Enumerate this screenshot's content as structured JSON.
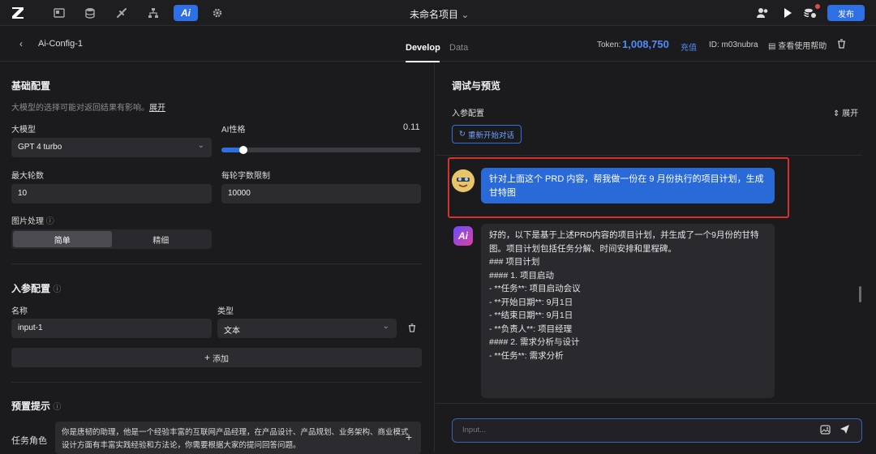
{
  "topbar": {
    "project_title": "未命名项目",
    "publish_label": "发布",
    "nav_icons": [
      "layout-icon",
      "database-icon",
      "plugin-icon",
      "workflow-icon",
      "ai-icon",
      "gear-icon"
    ],
    "ai_tab_label": "Ai"
  },
  "header": {
    "config_name": "Ai-Config-1",
    "tabs": [
      {
        "label": "Develop"
      },
      {
        "label": "Data"
      }
    ],
    "token_label": "Token:",
    "token_value": "1,008,750",
    "recharge_label": "充值",
    "id_label": "ID: m03nubra",
    "help_label": "查看使用帮助"
  },
  "left": {
    "basic_title": "基础配置",
    "basic_desc": "大模型的选择可能对返回结果有影响。",
    "expand_link": "展开",
    "model_label": "大模型",
    "model_value": "GPT 4 turbo",
    "personality_label": "AI性格",
    "personality_value": "0.11",
    "personality_fraction": 0.11,
    "rounds_label": "最大轮数",
    "rounds_value": "10",
    "words_label": "每轮字数限制",
    "words_value": "10000",
    "image_label": "图片处理",
    "image_options": [
      "简单",
      "精细"
    ],
    "params_title": "入参配置",
    "name_col": "名称",
    "type_col": "类型",
    "param_name": "input-1",
    "param_type": "文本",
    "add_label": "添加",
    "prompt_title": "预置提示",
    "role_label": "任务角色",
    "role_text": "你是唐韧的助理，他是一个经验丰富的互联网产品经理，在产品设计、产品规划、业务架构、商业模式设计方面有丰富实践经验和方法论，你需要根据大家的提问回答问题。"
  },
  "right": {
    "title": "调试与预览",
    "params_label": "入参配置",
    "expand_label": "展开",
    "restart_label": "重新开始对话",
    "user_message": "针对上面这个 PRD 内容，帮我做一份在 9 月份执行的项目计划，生成甘特图",
    "ai_lines": [
      "好的，以下是基于上述PRD内容的项目计划，并生成了一个9月份的甘特",
      "图。项目计划包括任务分解、时间安排和里程碑。",
      "",
      "### 项目计划",
      "",
      "#### 1. 项目启动",
      "- **任务**: 项目启动会议",
      "- **开始日期**: 9月1日",
      "- **结束日期**: 9月1日",
      "- **负责人**: 项目经理",
      "",
      "#### 2. 需求分析与设计",
      "- **任务**: 需求分析"
    ],
    "input_placeholder": "Input..."
  },
  "colors": {
    "accent": "#2f6fe4",
    "highlight": "#d6312c",
    "user_bubble": "#2a6ad8"
  }
}
